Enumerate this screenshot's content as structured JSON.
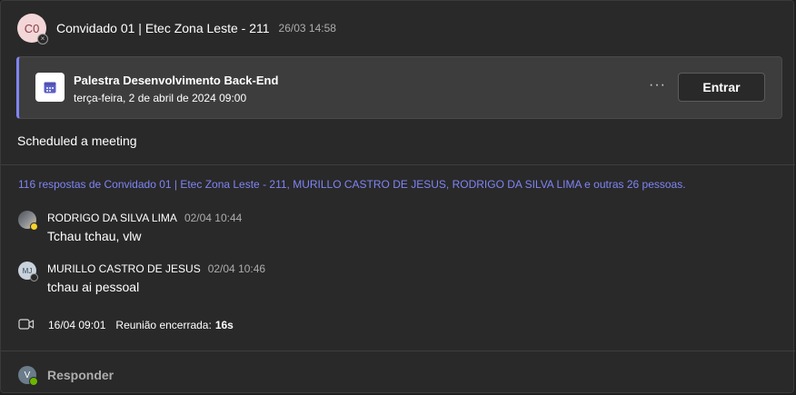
{
  "post": {
    "avatar_initials": "C0",
    "author": "Convidado 01 | Etec Zona Leste - 211",
    "timestamp": "26/03 14:58"
  },
  "meeting": {
    "icon": "calendar-icon",
    "title": "Palestra Desenvolvimento Back-End",
    "date": "terça-feira, 2 de abril de 2024 09:00",
    "more_label": "···",
    "join_label": "Entrar"
  },
  "scheduled_text": "Scheduled a meeting",
  "replies_summary": "116 respostas de Convidado 01 | Etec Zona Leste - 211, MURILLO CASTRO DE JESUS, RODRIGO DA SILVA LIMA e outras 26 pessoas.",
  "replies": [
    {
      "author": "RODRIGO DA SILVA LIMA",
      "time": "02/04 10:44",
      "text": "Tchau tchau, vlw",
      "avatar": "photo"
    },
    {
      "author": "MURILLO CASTRO DE JESUS",
      "time": "02/04 10:46",
      "text": "tchau ai pessoal",
      "avatar_initials": "MJ"
    }
  ],
  "meeting_end": {
    "icon": "video-camera-icon",
    "date": "16/04 09:01",
    "label": "Reunião encerrada:",
    "duration": "16s"
  },
  "reply_bar": {
    "avatar_initials": "V",
    "label": "Responder"
  },
  "colors": {
    "accent": "#7f85f5",
    "background": "#292929",
    "card": "#3d3d3d",
    "presence_available": "#6bb700"
  }
}
